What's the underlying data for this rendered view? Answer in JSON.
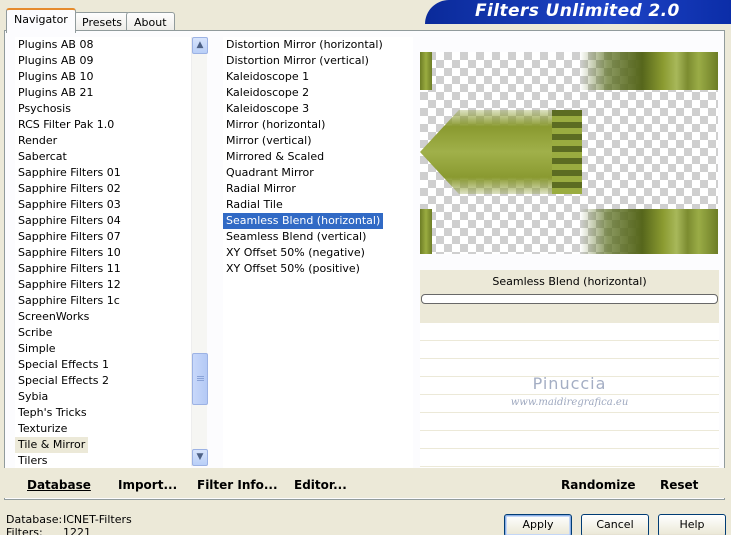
{
  "tabs": [
    {
      "label": "Navigator",
      "active": true
    },
    {
      "label": "Presets",
      "active": false
    },
    {
      "label": "About",
      "active": false
    }
  ],
  "banner": {
    "title": "Filters Unlimited 2.0"
  },
  "categories": {
    "items": [
      "Plugins AB 08",
      "Plugins AB 09",
      "Plugins AB 10",
      "Plugins AB 21",
      "Psychosis",
      "RCS Filter Pak 1.0",
      "Render",
      "Sabercat",
      "Sapphire Filters 01",
      "Sapphire Filters 02",
      "Sapphire Filters 03",
      "Sapphire Filters 04",
      "Sapphire Filters 07",
      "Sapphire Filters 10",
      "Sapphire Filters 11",
      "Sapphire Filters 12",
      "Sapphire Filters 1c",
      "ScreenWorks",
      "Scribe",
      "Simple",
      "Special Effects 1",
      "Special Effects 2",
      "Sybia",
      "Teph's Tricks",
      "Texturize",
      "Tile & Mirror",
      "Tilers"
    ],
    "current": "Tile & Mirror"
  },
  "filters": {
    "items": [
      "Distortion Mirror (horizontal)",
      "Distortion Mirror (vertical)",
      "Kaleidoscope 1",
      "Kaleidoscope 2",
      "Kaleidoscope 3",
      "Mirror (horizontal)",
      "Mirror (vertical)",
      "Mirrored & Scaled",
      "Quadrant Mirror",
      "Radial Mirror",
      "Radial Tile",
      "Seamless Blend (horizontal)",
      "Seamless Blend (vertical)",
      "XY Offset 50% (negative)",
      "XY Offset 50% (positive)"
    ],
    "selected": "Seamless Blend (horizontal)"
  },
  "preview": {
    "filter_name": "Seamless Blend (horizontal)",
    "watermark": "Pinuccia",
    "watermark_url": "www.maidiregrafica.eu",
    "colors": {
      "olive": "#8a9a30",
      "dark_olive": "#4a5a1a",
      "light_olive": "#a8b85a"
    }
  },
  "actions": {
    "database": "Database",
    "import": "Import...",
    "filter_info": "Filter Info...",
    "editor": "Editor...",
    "randomize": "Randomize",
    "reset": "Reset"
  },
  "footer": {
    "database_label": "Database:",
    "database_value": "ICNET-Filters",
    "filters_label": "Filters:",
    "filters_value": "1221",
    "apply": "Apply",
    "cancel": "Cancel",
    "help": "Help"
  }
}
